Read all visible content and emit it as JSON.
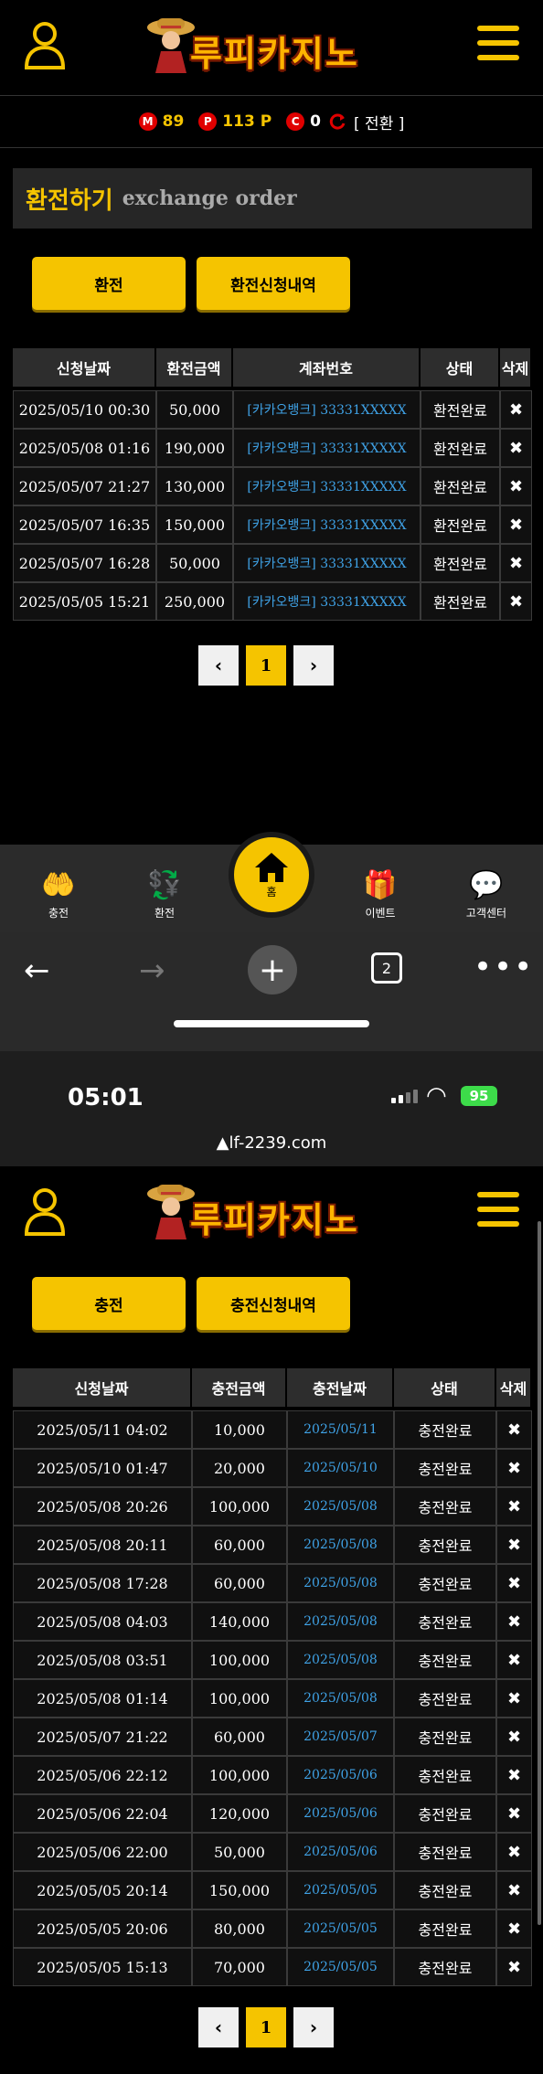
{
  "logo": {
    "text": "루피카지노"
  },
  "points": {
    "m_badge": "M",
    "m_value": "89",
    "p_badge": "P",
    "p_value": "113 P",
    "c_badge": "C",
    "c_value": "0",
    "switch_label": "[ 전환 ]"
  },
  "exchange": {
    "title_kr": "환전하기",
    "title_en": "exchange order",
    "btn_exchange": "환전",
    "btn_history": "환전신청내역",
    "headers": [
      "신청날짜",
      "환전금액",
      "계좌번호",
      "상태",
      "삭제"
    ],
    "rows": [
      {
        "date": "2025/05/10 00:30",
        "amount": "50,000",
        "account": "[카카오뱅크] 33331XXXXX",
        "status": "환전완료"
      },
      {
        "date": "2025/05/08 01:16",
        "amount": "190,000",
        "account": "[카카오뱅크] 33331XXXXX",
        "status": "환전완료"
      },
      {
        "date": "2025/05/07 21:27",
        "amount": "130,000",
        "account": "[카카오뱅크] 33331XXXXX",
        "status": "환전완료"
      },
      {
        "date": "2025/05/07 16:35",
        "amount": "150,000",
        "account": "[카카오뱅크] 33331XXXXX",
        "status": "환전완료"
      },
      {
        "date": "2025/05/07 16:28",
        "amount": "50,000",
        "account": "[카카오뱅크] 33331XXXXX",
        "status": "환전완료"
      },
      {
        "date": "2025/05/05 15:21",
        "amount": "250,000",
        "account": "[카카오뱅크] 33331XXXXX",
        "status": "환전완료"
      }
    ],
    "delete_glyph": "✖",
    "page": "1"
  },
  "bottom_nav": {
    "charge": "충전",
    "exchange": "환전",
    "home": "홈",
    "event": "이벤트",
    "support": "고객센터"
  },
  "browser": {
    "tabs_count": "2"
  },
  "status": {
    "time": "05:01",
    "battery": "95",
    "url": "lf-2239.com"
  },
  "deposit": {
    "btn_charge": "충전",
    "btn_history": "충전신청내역",
    "headers": [
      "신청날짜",
      "충전금액",
      "충전날짜",
      "상태",
      "삭제"
    ],
    "rows": [
      {
        "date": "2025/05/11 04:02",
        "amount": "10,000",
        "charge_date": "2025/05/11",
        "status": "충전완료"
      },
      {
        "date": "2025/05/10 01:47",
        "amount": "20,000",
        "charge_date": "2025/05/10",
        "status": "충전완료"
      },
      {
        "date": "2025/05/08 20:26",
        "amount": "100,000",
        "charge_date": "2025/05/08",
        "status": "충전완료"
      },
      {
        "date": "2025/05/08 20:11",
        "amount": "60,000",
        "charge_date": "2025/05/08",
        "status": "충전완료"
      },
      {
        "date": "2025/05/08 17:28",
        "amount": "60,000",
        "charge_date": "2025/05/08",
        "status": "충전완료"
      },
      {
        "date": "2025/05/08 04:03",
        "amount": "140,000",
        "charge_date": "2025/05/08",
        "status": "충전완료"
      },
      {
        "date": "2025/05/08 03:51",
        "amount": "100,000",
        "charge_date": "2025/05/08",
        "status": "충전완료"
      },
      {
        "date": "2025/05/08 01:14",
        "amount": "100,000",
        "charge_date": "2025/05/08",
        "status": "충전완료"
      },
      {
        "date": "2025/05/07 21:22",
        "amount": "60,000",
        "charge_date": "2025/05/07",
        "status": "충전완료"
      },
      {
        "date": "2025/05/06 22:12",
        "amount": "100,000",
        "charge_date": "2025/05/06",
        "status": "충전완료"
      },
      {
        "date": "2025/05/06 22:04",
        "amount": "120,000",
        "charge_date": "2025/05/06",
        "status": "충전완료"
      },
      {
        "date": "2025/05/06 22:00",
        "amount": "50,000",
        "charge_date": "2025/05/06",
        "status": "충전완료"
      },
      {
        "date": "2025/05/05 20:14",
        "amount": "150,000",
        "charge_date": "2025/05/05",
        "status": "충전완료"
      },
      {
        "date": "2025/05/05 20:06",
        "amount": "80,000",
        "charge_date": "2025/05/05",
        "status": "충전완료"
      },
      {
        "date": "2025/05/05 15:13",
        "amount": "70,000",
        "charge_date": "2025/05/05",
        "status": "충전완료"
      }
    ],
    "page": "1"
  },
  "colors": {
    "accent": "#f5c400",
    "link": "#3fa2e6",
    "badge": "#e00000"
  }
}
